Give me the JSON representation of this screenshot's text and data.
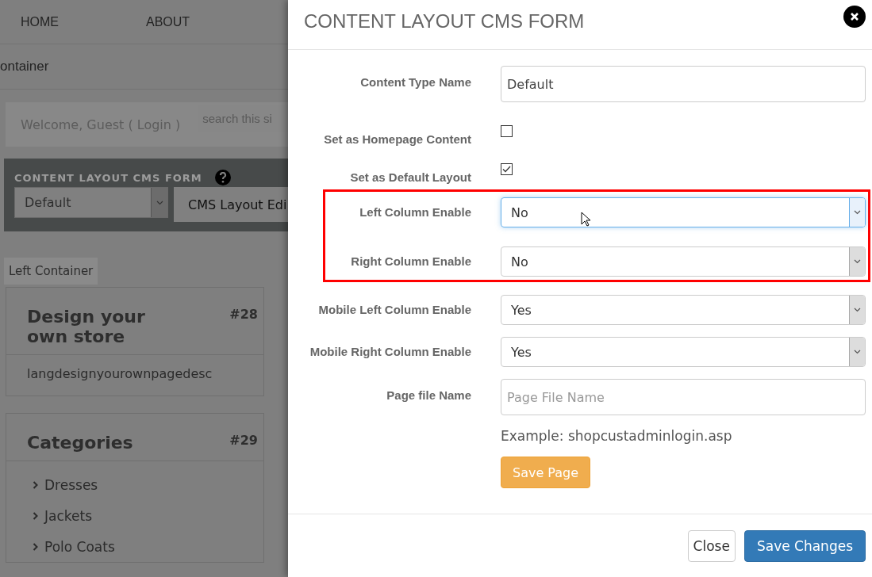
{
  "background_page": {
    "nav": [
      {
        "label": "HOME"
      },
      {
        "label": "ABOUT"
      }
    ],
    "breadcrumb": "ontainer",
    "welcome": "Welcome, Guest ( Login )",
    "search": {
      "placeholder": "search this si"
    },
    "cms_panel": {
      "title": "CONTENT LAYOUT CMS FORM",
      "select": "Default",
      "button": "CMS Layout Edi"
    },
    "container_tag": "Left Container",
    "cards": [
      {
        "title": "Design your own store",
        "number": "#28",
        "body": "langdesignyourownpagedesc"
      },
      {
        "title": "Categories",
        "number": "#29",
        "items": [
          "Dresses",
          "Jackets",
          "Polo Coats"
        ]
      }
    ]
  },
  "modal": {
    "title": "CONTENT LAYOUT CMS FORM",
    "fields": [
      {
        "kind": "text",
        "label": "Content Type Name",
        "value": "Default",
        "highlighted": false
      },
      {
        "kind": "checkbox",
        "label": "Set as Homepage Content",
        "checked": false,
        "highlighted": false
      },
      {
        "kind": "checkbox",
        "label": "Set as Default Layout",
        "checked": true,
        "highlighted": false
      },
      {
        "kind": "select",
        "label": "Left Column Enable",
        "value": "No",
        "focused": true,
        "highlighted": true
      },
      {
        "kind": "select",
        "label": "Right Column Enable",
        "value": "No",
        "focused": false,
        "highlighted": true
      },
      {
        "kind": "select",
        "label": "Mobile Left Column Enable",
        "value": "Yes",
        "focused": false,
        "highlighted": false
      },
      {
        "kind": "select",
        "label": "Mobile Right Column Enable",
        "value": "Yes",
        "focused": false,
        "highlighted": false
      },
      {
        "kind": "text",
        "label": "Page file Name",
        "placeholder": "Page File Name",
        "hint": "Example: shopcustadminlogin.asp",
        "highlighted": false
      }
    ],
    "save_page": "Save Page",
    "buttons": [
      {
        "label": "Close",
        "kind": "default"
      },
      {
        "label": "Save Changes",
        "kind": "primary"
      }
    ]
  }
}
